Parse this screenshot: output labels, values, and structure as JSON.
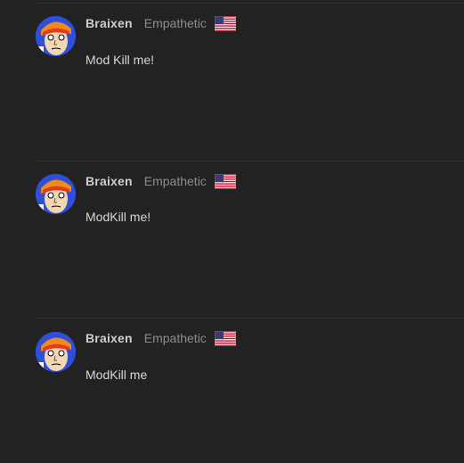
{
  "posts": [
    {
      "username": "Braixen",
      "rank": "Empathetic",
      "flag_icon": "us-flag-icon",
      "message": "Mod Kill me!"
    },
    {
      "username": "Braixen",
      "rank": "Empathetic",
      "flag_icon": "us-flag-icon",
      "message": "ModKill me!"
    },
    {
      "username": "Braixen",
      "rank": "Empathetic",
      "flag_icon": "us-flag-icon",
      "message": "ModKill me"
    }
  ],
  "colors": {
    "background": "#222222",
    "divider": "#303030",
    "username": "#cfcfcf",
    "rank": "#8d8d8d",
    "message": "#d8d8d8"
  }
}
